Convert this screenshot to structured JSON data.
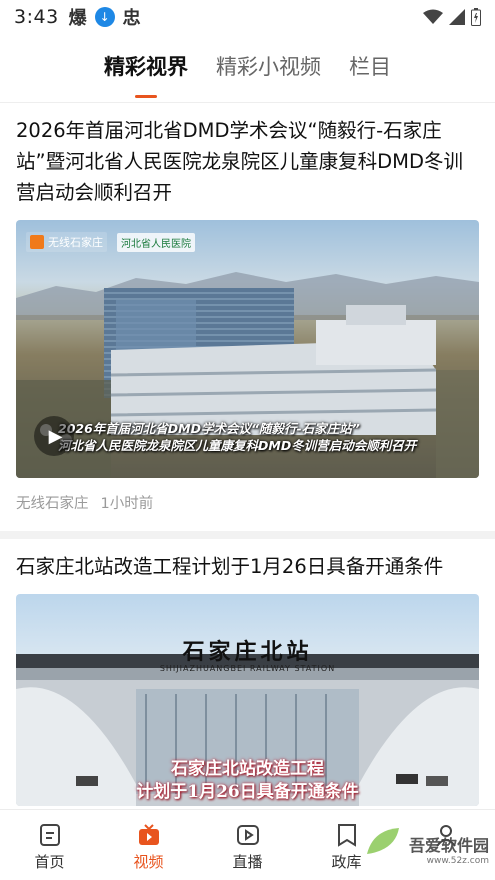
{
  "status_bar": {
    "time": "3:43",
    "glyph_1": "爆",
    "glyph_2": "忠",
    "icons": [
      "download-icon",
      "wifi-icon",
      "signal-icon",
      "battery-icon"
    ]
  },
  "top_tabs": [
    {
      "label": "精彩视界",
      "active": true
    },
    {
      "label": "精彩小视频",
      "active": false
    },
    {
      "label": "栏目",
      "active": false
    }
  ],
  "articles": [
    {
      "title": "2026年首届河北省DMD学术会议“随毅行-石家庄站”暨河北省人民医院龙泉院区儿童康复科DMD冬训营启动会顺利召开",
      "source": "无线石家庄",
      "time": "1小时前",
      "image": {
        "badge_text": "无线石家庄",
        "partner_logo": "河北省人民医院",
        "caption_line_1": "2026年首届河北省DMD学术会议“随毅行-石家庄站”",
        "caption_line_2": "河北省人民医院龙泉院区儿童康复科DMD冬训营启动会顺利召开"
      }
    },
    {
      "title": "石家庄北站改造工程计划于1月26日具备开通条件",
      "image": {
        "sign": "石家庄北站",
        "sign_en": "SHIJIAZHUANGBEI RAILWAY STATION",
        "caption_line_1": "石家庄北站改造工程",
        "caption_line_2": "计划于1月26日具备开通条件"
      }
    }
  ],
  "bottom_nav": [
    {
      "label": "首页",
      "icon": "home-icon",
      "active": false
    },
    {
      "label": "视频",
      "icon": "video-tv-icon",
      "active": true
    },
    {
      "label": "直播",
      "icon": "live-play-icon",
      "active": false
    },
    {
      "label": "政库",
      "icon": "bookmark-icon",
      "active": false
    },
    {
      "label": "",
      "icon": "profile-icon",
      "active": false
    }
  ],
  "watermark": {
    "text": "吾爱软件园",
    "url": "www.52z.com"
  },
  "colors": {
    "accent": "#e8541e",
    "text": "#111111",
    "muted": "#9a9a9a",
    "separator": "#f2f2f2"
  }
}
